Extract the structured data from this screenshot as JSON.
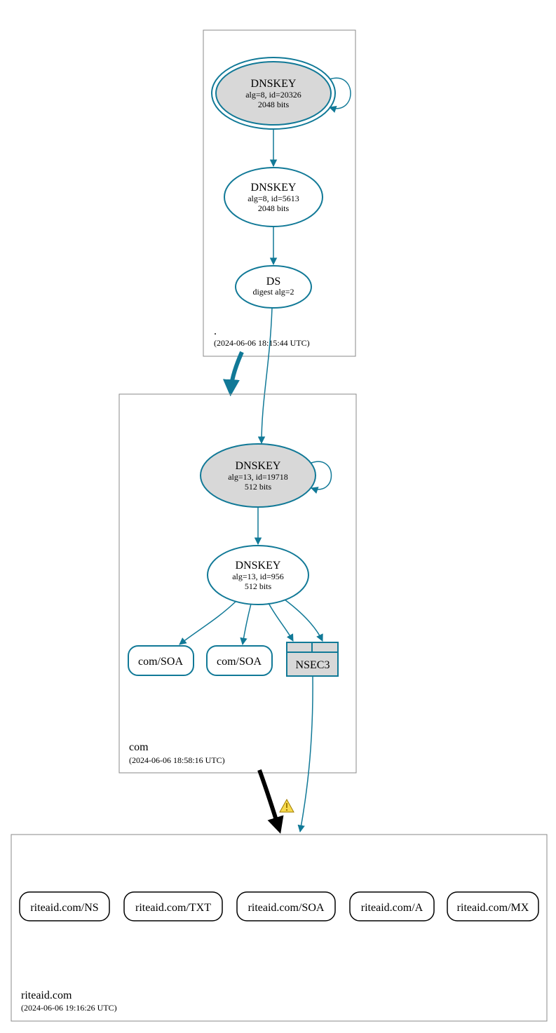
{
  "zones": {
    "root": {
      "name": ".",
      "timestamp": "(2024-06-06 18:15:44 UTC)"
    },
    "com": {
      "name": "com",
      "timestamp": "(2024-06-06 18:58:16 UTC)"
    },
    "riteaid": {
      "name": "riteaid.com",
      "timestamp": "(2024-06-06 19:16:26 UTC)"
    }
  },
  "nodes": {
    "root_ksk": {
      "title": "DNSKEY",
      "line1": "alg=8, id=20326",
      "line2": "2048 bits"
    },
    "root_zsk": {
      "title": "DNSKEY",
      "line1": "alg=8, id=5613",
      "line2": "2048 bits"
    },
    "root_ds": {
      "title": "DS",
      "line1": "digest alg=2"
    },
    "com_ksk": {
      "title": "DNSKEY",
      "line1": "alg=13, id=19718",
      "line2": "512 bits"
    },
    "com_zsk": {
      "title": "DNSKEY",
      "line1": "alg=13, id=956",
      "line2": "512 bits"
    },
    "com_soa1": {
      "title": "com/SOA"
    },
    "com_soa2": {
      "title": "com/SOA"
    },
    "com_nsec3": {
      "title": "NSEC3"
    },
    "ra_ns": {
      "title": "riteaid.com/NS"
    },
    "ra_txt": {
      "title": "riteaid.com/TXT"
    },
    "ra_soa": {
      "title": "riteaid.com/SOA"
    },
    "ra_a": {
      "title": "riteaid.com/A"
    },
    "ra_mx": {
      "title": "riteaid.com/MX"
    }
  }
}
